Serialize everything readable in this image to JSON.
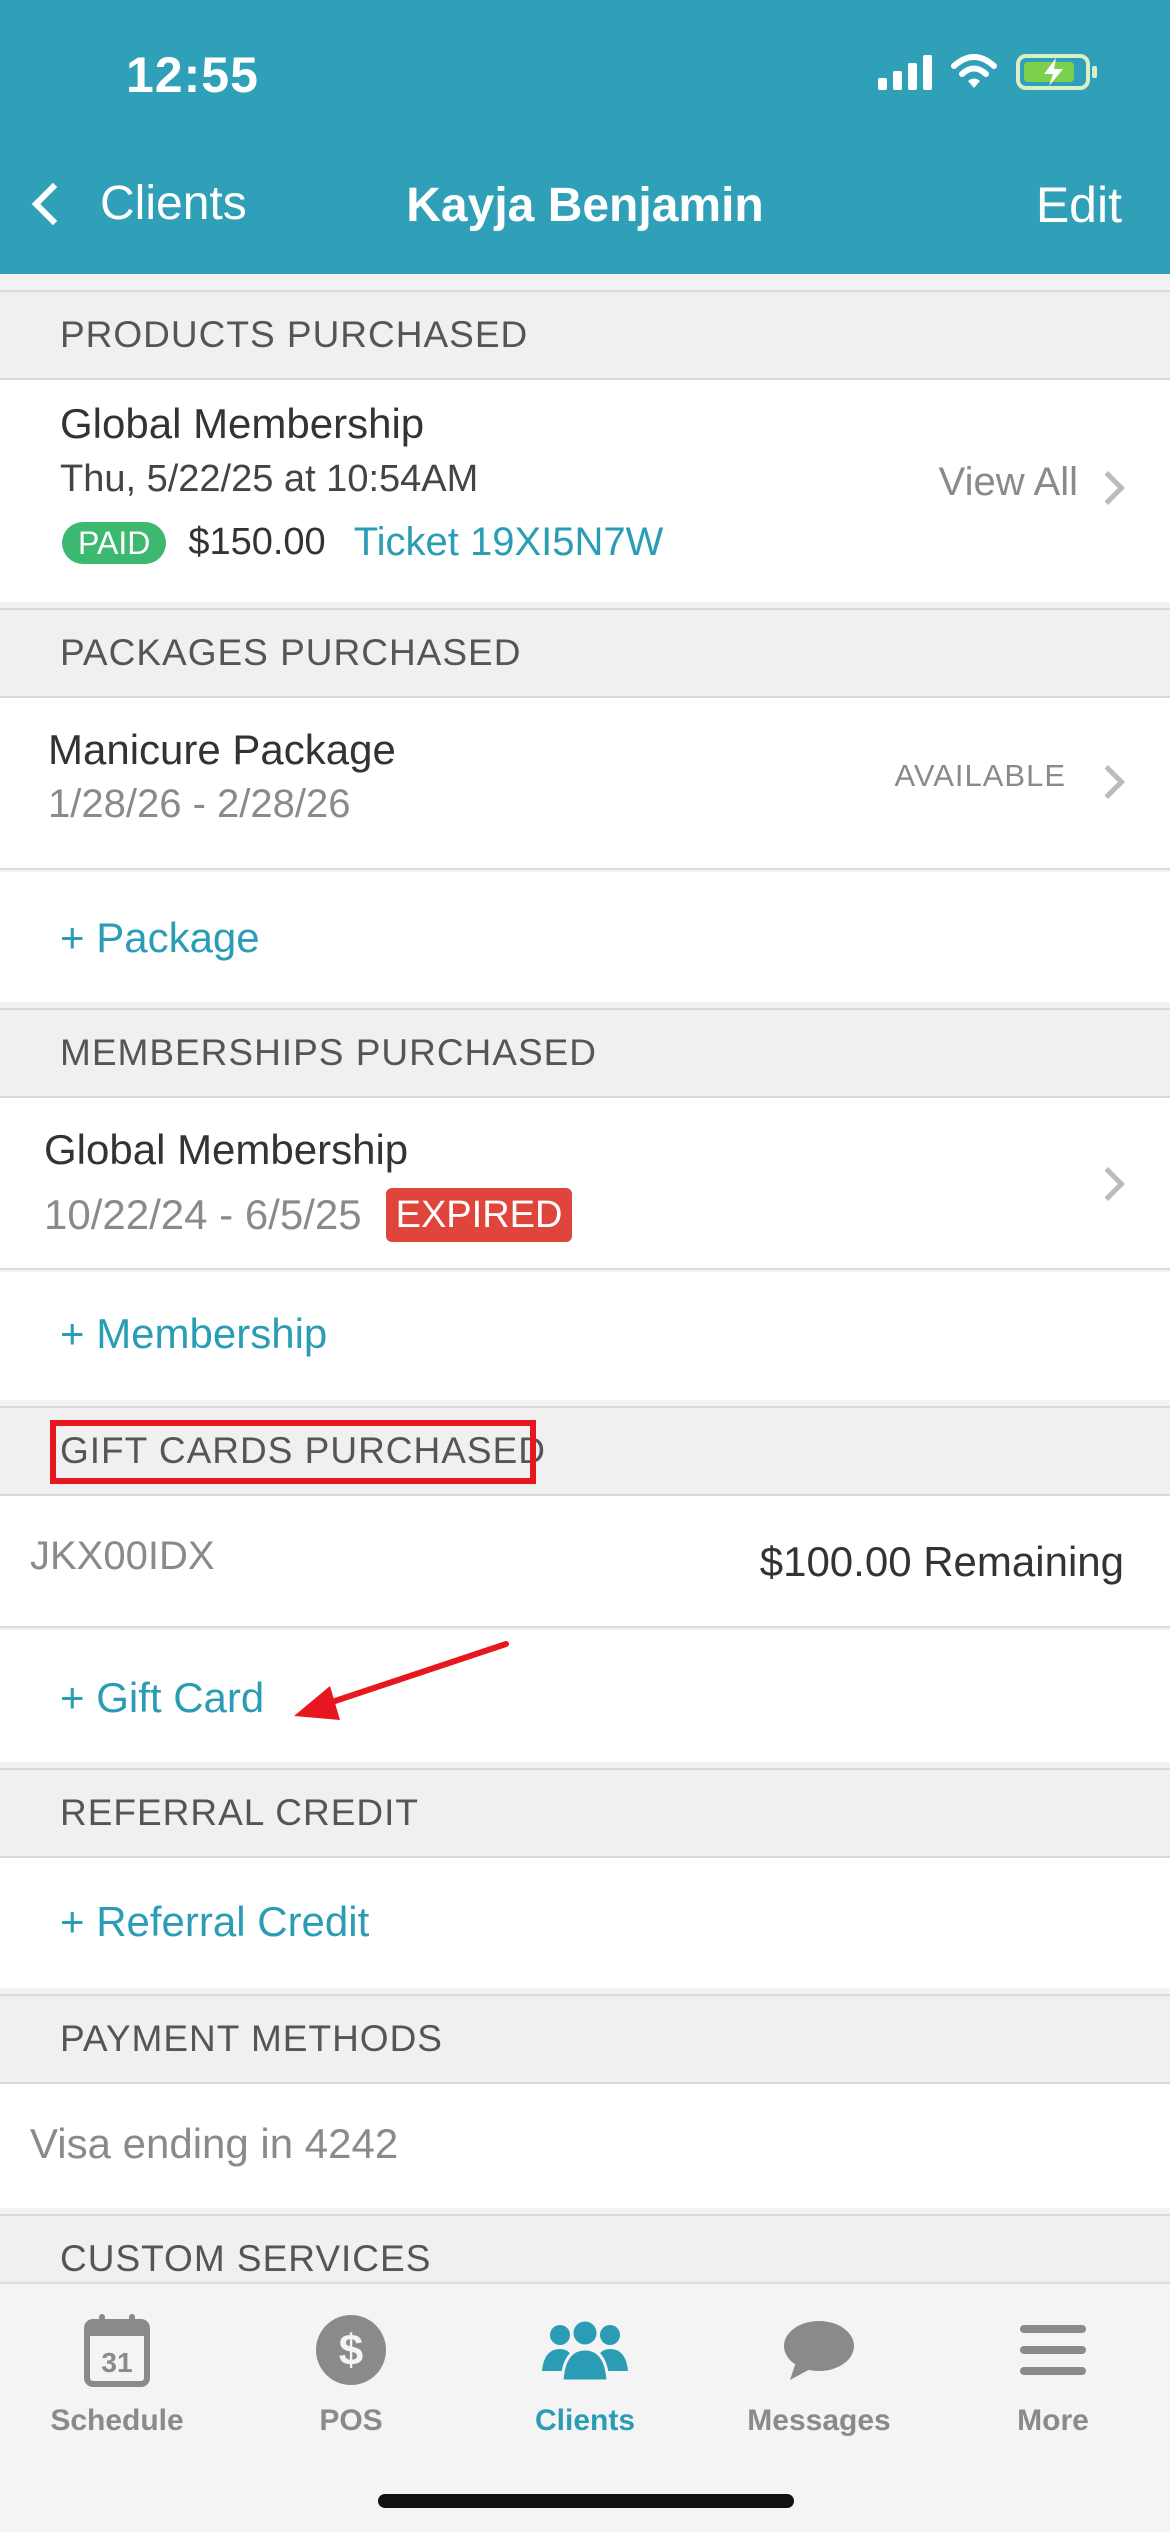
{
  "status_bar": {
    "time": "12:55"
  },
  "nav": {
    "back_label": "Clients",
    "title": "Kayja Benjamin",
    "edit_label": "Edit"
  },
  "products": {
    "header": "PRODUCTS PURCHASED",
    "item_name": "Global Membership",
    "item_date": "Thu, 5/22/25 at 10:54AM",
    "paid_badge": "PAID",
    "amount": "$150.00",
    "ticket": "Ticket 19XI5N7W",
    "view_all": "View All"
  },
  "packages": {
    "header": "PACKAGES PURCHASED",
    "item_name": "Manicure Package",
    "item_dates": "1/28/26 - 2/28/26",
    "item_status": "AVAILABLE",
    "add_label": "+ Package"
  },
  "memberships": {
    "header": "MEMBERSHIPS PURCHASED",
    "item_name": "Global Membership",
    "item_dates": "10/22/24 - 6/5/25",
    "expired_badge": "EXPIRED",
    "add_label": "+ Membership"
  },
  "gift_cards": {
    "header": "GIFT CARDS PURCHASED",
    "card_code": "JKX00IDX",
    "card_remaining": "$100.00 Remaining",
    "add_label": "+ Gift Card"
  },
  "referral": {
    "header": "REFERRAL CREDIT",
    "add_label": "+ Referral Credit"
  },
  "payment": {
    "header": "PAYMENT METHODS",
    "card": "Visa ending in 4242"
  },
  "custom_services": {
    "header": "CUSTOM SERVICES"
  },
  "tabbar": {
    "calendar_day": "31",
    "items": [
      {
        "label": "Schedule",
        "icon": "calendar-icon"
      },
      {
        "label": "POS",
        "icon": "dollar-icon"
      },
      {
        "label": "Clients",
        "icon": "clients-icon",
        "active": true
      },
      {
        "label": "Messages",
        "icon": "chat-bubble-icon"
      },
      {
        "label": "More",
        "icon": "menu-icon"
      }
    ]
  },
  "colors": {
    "header_bg": "#30a0b8",
    "link": "#2a9db5",
    "paid": "#3cb870",
    "expired": "#e0453c",
    "annotation": "#e8171f"
  }
}
